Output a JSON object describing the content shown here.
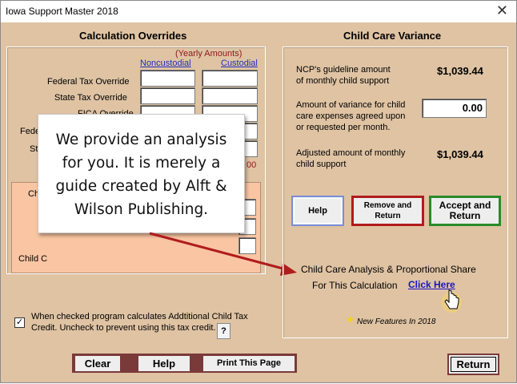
{
  "window": {
    "title": "Iowa Support Master 2018",
    "close_symbol": "✕"
  },
  "overrides": {
    "header": "Calculation  Overrides",
    "yearly_amounts": "(Yearly Amounts)",
    "col_noncustodial": "Noncustodial",
    "col_custodial": "Custodial",
    "rows": {
      "federal": "Federal Tax Override",
      "state": "State Tax Override",
      "fica": "FICA Override",
      "fede_partial": "Fede",
      "sta_partial": "Sta"
    },
    "partial_value": "00",
    "inner_chi": "Chi",
    "inner_child": "Child C"
  },
  "callout": {
    "text_lines": [
      "We provide an analysis",
      "for you. It is merely a",
      "guide created by Alft &",
      "Wilson Publishing."
    ]
  },
  "variance": {
    "header": "Child Care Variance",
    "guideline_label_1": "NCP's guideline amount",
    "guideline_label_2": "of monthly child support",
    "guideline_value": "$1,039.44",
    "variance_label_1": "Amount of variance for child",
    "variance_label_2": "care expenses agreed upon",
    "variance_label_3": "or requested per month.",
    "variance_value": "0.00",
    "adjusted_label_1": "Adjusted amount of monthly",
    "adjusted_label_2": "child support",
    "adjusted_value": "$1,039.44",
    "buttons": {
      "help": "Help",
      "remove_1": "Remove and",
      "remove_2": "Return",
      "accept_1": "Accept and",
      "accept_2": "Return"
    },
    "analysis_line1": "Child Care Analysis & Proportional Share",
    "analysis_line2": "For This Calculation",
    "click_here": "Click Here",
    "new_features": "New Features In 2018",
    "star_color": "#f2d21b"
  },
  "checkbox": {
    "checked_mark": "✓",
    "label_1": "When checked program calculates Addtitional Child Tax",
    "label_2": "Credit.  Uncheck to prevent using this tax credit.",
    "help_q": "?"
  },
  "bottom": {
    "clear": "Clear",
    "help": "Help",
    "print": "Print This Page",
    "return": "Return"
  },
  "colors": {
    "bg": "#dfc3a3",
    "accent_red": "#b01c1c",
    "accent_green": "#2a8a2a",
    "accent_blue": "#7a8ed8",
    "link": "#1a14c8",
    "maroon": "#7a3a3a"
  }
}
